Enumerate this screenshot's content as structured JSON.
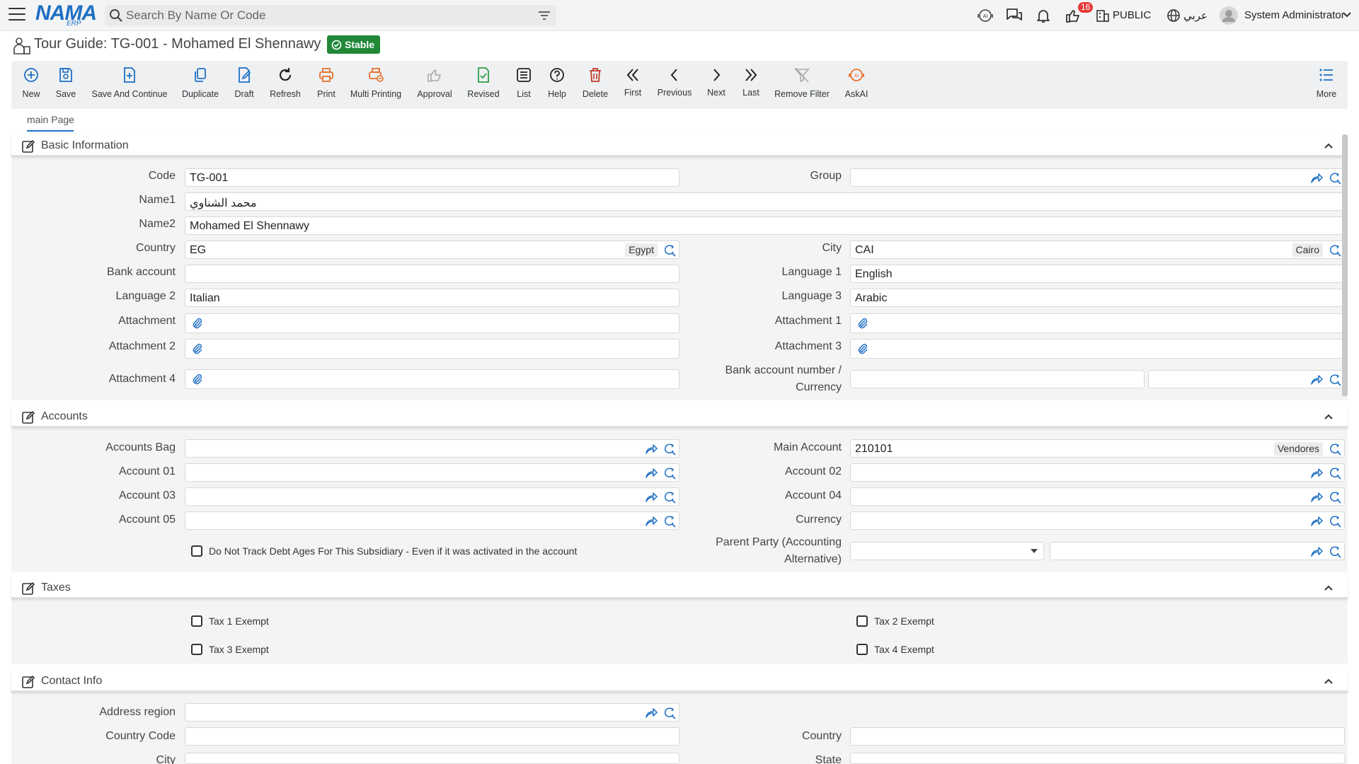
{
  "topbar": {
    "logo": "NAMA",
    "logo_sub": "ERP",
    "search_placeholder": "Search By Name Or Code",
    "notification_count": "16",
    "company": "PUBLIC",
    "language": "عربي",
    "user": "System Administrator"
  },
  "title": {
    "text": "Tour Guide: TG-001 - Mohamed El Shennawy",
    "status": "Stable"
  },
  "toolbar": [
    {
      "label": "New",
      "icon": "plus-circle-icon"
    },
    {
      "label": "Save",
      "icon": "save-icon"
    },
    {
      "label": "Save And Continue",
      "icon": "save-continue-icon"
    },
    {
      "label": "Duplicate",
      "icon": "duplicate-icon"
    },
    {
      "label": "Draft",
      "icon": "draft-icon"
    },
    {
      "label": "Refresh",
      "icon": "refresh-icon"
    },
    {
      "label": "Print",
      "icon": "print-icon"
    },
    {
      "label": "Multi Printing",
      "icon": "multi-print-icon"
    },
    {
      "label": "Approval",
      "icon": "thumbs-up-icon"
    },
    {
      "label": "Revised",
      "icon": "revised-icon"
    },
    {
      "label": "List",
      "icon": "list-icon"
    },
    {
      "label": "Help",
      "icon": "help-icon"
    },
    {
      "label": "Delete",
      "icon": "trash-icon"
    },
    {
      "label": "First",
      "icon": "double-chevron-left-icon"
    },
    {
      "label": "Previous",
      "icon": "chevron-left-icon"
    },
    {
      "label": "Next",
      "icon": "chevron-right-icon"
    },
    {
      "label": "Last",
      "icon": "double-chevron-right-icon"
    },
    {
      "label": "Remove Filter",
      "icon": "remove-filter-icon"
    },
    {
      "label": "AskAI",
      "icon": "ai-icon"
    },
    {
      "label": "More",
      "icon": "more-list-icon"
    }
  ],
  "tab": "main Page",
  "sections": {
    "basic": "Basic Information",
    "accounts": "Accounts",
    "taxes": "Taxes",
    "contact": "Contact Info"
  },
  "basic": {
    "code_label": "Code",
    "code": "TG-001",
    "group_label": "Group",
    "name1_label": "Name1",
    "name1": "محمد الشناوي",
    "name2_label": "Name2",
    "name2": "Mohamed El Shennawy",
    "country_label": "Country",
    "country": "EG",
    "country_name": "Egypt",
    "city_label": "City",
    "city": "CAI",
    "city_name": "Cairo",
    "bank_label": "Bank account",
    "lang1_label": "Language 1",
    "lang1": "English",
    "lang2_label": "Language 2",
    "lang2": "Italian",
    "lang3_label": "Language 3",
    "lang3": "Arabic",
    "att_label": "Attachment",
    "att1_label": "Attachment 1",
    "att2_label": "Attachment 2",
    "att3_label": "Attachment 3",
    "att4_label": "Attachment 4",
    "bank_curr_label": "Bank account number / Currency"
  },
  "accounts": {
    "bag_label": "Accounts Bag",
    "main_label": "Main Account",
    "main": "210101",
    "main_name": "Vendores",
    "a01_label": "Account 01",
    "a02_label": "Account 02",
    "a03_label": "Account 03",
    "a04_label": "Account 04",
    "a05_label": "Account 05",
    "currency_label": "Currency",
    "debt_label": "Do Not Track Debt Ages For This Subsidiary - Even if it was activated in the account",
    "parent_label": "Parent Party (Accounting Alternative)"
  },
  "taxes": {
    "t1": "Tax 1 Exempt",
    "t2": "Tax 2 Exempt",
    "t3": "Tax 3 Exempt",
    "t4": "Tax 4 Exempt"
  },
  "contact": {
    "region_label": "Address region",
    "ccode_label": "Country Code",
    "country_label": "Country",
    "city_label": "City",
    "state_label": "State"
  }
}
